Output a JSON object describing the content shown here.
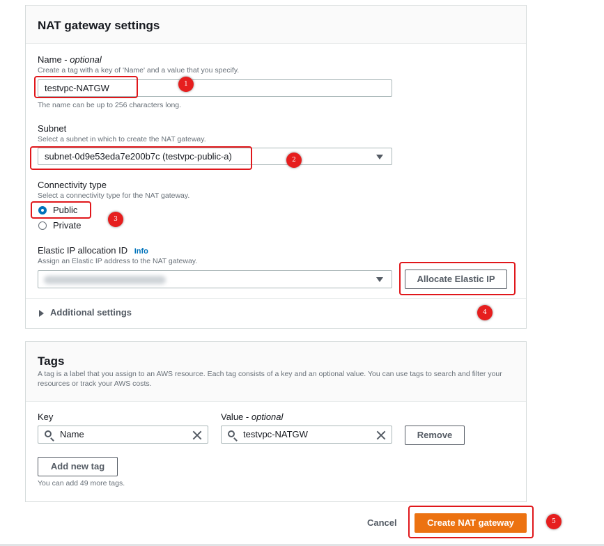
{
  "nat_settings": {
    "title": "NAT gateway settings",
    "name_label": "Name -",
    "name_optional": "optional",
    "name_desc": "Create a tag with a key of 'Name' and a value that you specify.",
    "name_value": "testvpc-NATGW",
    "name_hint": "The name can be up to 256 characters long.",
    "subnet_label": "Subnet",
    "subnet_desc": "Select a subnet in which to create the NAT gateway.",
    "subnet_value": "subnet-0d9e53eda7e200b7c (testvpc-public-a)",
    "connectivity_label": "Connectivity type",
    "connectivity_desc": "Select a connectivity type for the NAT gateway.",
    "connectivity_options": [
      {
        "label": "Public",
        "selected": true
      },
      {
        "label": "Private",
        "selected": false
      }
    ],
    "eip_label": "Elastic IP allocation ID",
    "eip_info": "Info",
    "eip_desc": "Assign an Elastic IP address to the NAT gateway.",
    "allocate_button": "Allocate Elastic IP",
    "additional_settings": "Additional settings"
  },
  "tags": {
    "title": "Tags",
    "desc": "A tag is a label that you assign to an AWS resource. Each tag consists of a key and an optional value. You can use tags to search and filter your resources or track your AWS costs.",
    "key_label": "Key",
    "value_label": "Value -",
    "value_optional": "optional",
    "rows": [
      {
        "key": "Name",
        "value": "testvpc-NATGW"
      }
    ],
    "remove_button": "Remove",
    "add_button": "Add new tag",
    "remaining": "You can add 49 more tags."
  },
  "footer": {
    "cancel": "Cancel",
    "create": "Create NAT gateway"
  },
  "markers": [
    "1",
    "2",
    "3",
    "4",
    "5"
  ],
  "colors": {
    "primary": "#ec7211",
    "info_link": "#0073bb",
    "annotation_red": "#e0171b",
    "radio_selected": "#0073bb"
  },
  "icons": [
    "dropdown-caret-icon",
    "search-icon",
    "clear-icon",
    "expand-triangle-icon"
  ]
}
